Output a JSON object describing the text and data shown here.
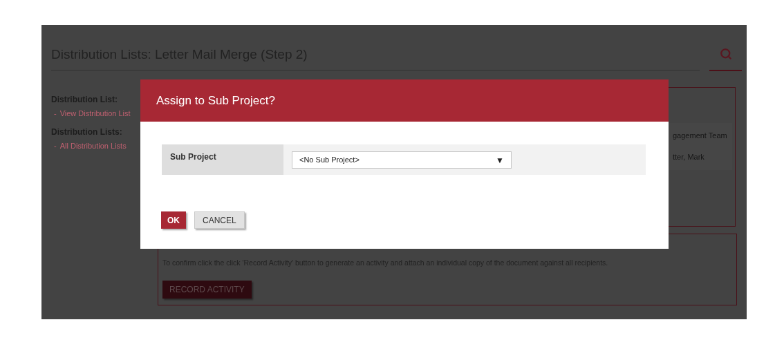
{
  "page": {
    "title": "Distribution Lists: Letter Mail Merge (Step 2)"
  },
  "sidebar": {
    "sections": [
      {
        "heading": "Distribution List:",
        "links": [
          {
            "bullet": "-",
            "label": "View Distribution List"
          }
        ]
      },
      {
        "heading": "Distribution Lists:",
        "links": [
          {
            "bullet": "-",
            "label": "All Distribution Lists"
          }
        ]
      }
    ]
  },
  "recipients_panel": {
    "texts": [
      "gagement Team",
      "tter, Mark"
    ]
  },
  "confirm_panel": {
    "message": "To confirm click the click 'Record Activity' button to generate an activity and attach an individual copy of the document against all recipients.",
    "button": "RECORD ACTIVITY"
  },
  "dialog": {
    "title": "Assign to Sub Project?",
    "field": {
      "label": "Sub Project",
      "value": "<No Sub Project>",
      "arrow": "▼"
    },
    "buttons": [
      {
        "label": "OK",
        "kind": "primary"
      },
      {
        "label": "CANCEL",
        "kind": "secondary"
      }
    ]
  }
}
